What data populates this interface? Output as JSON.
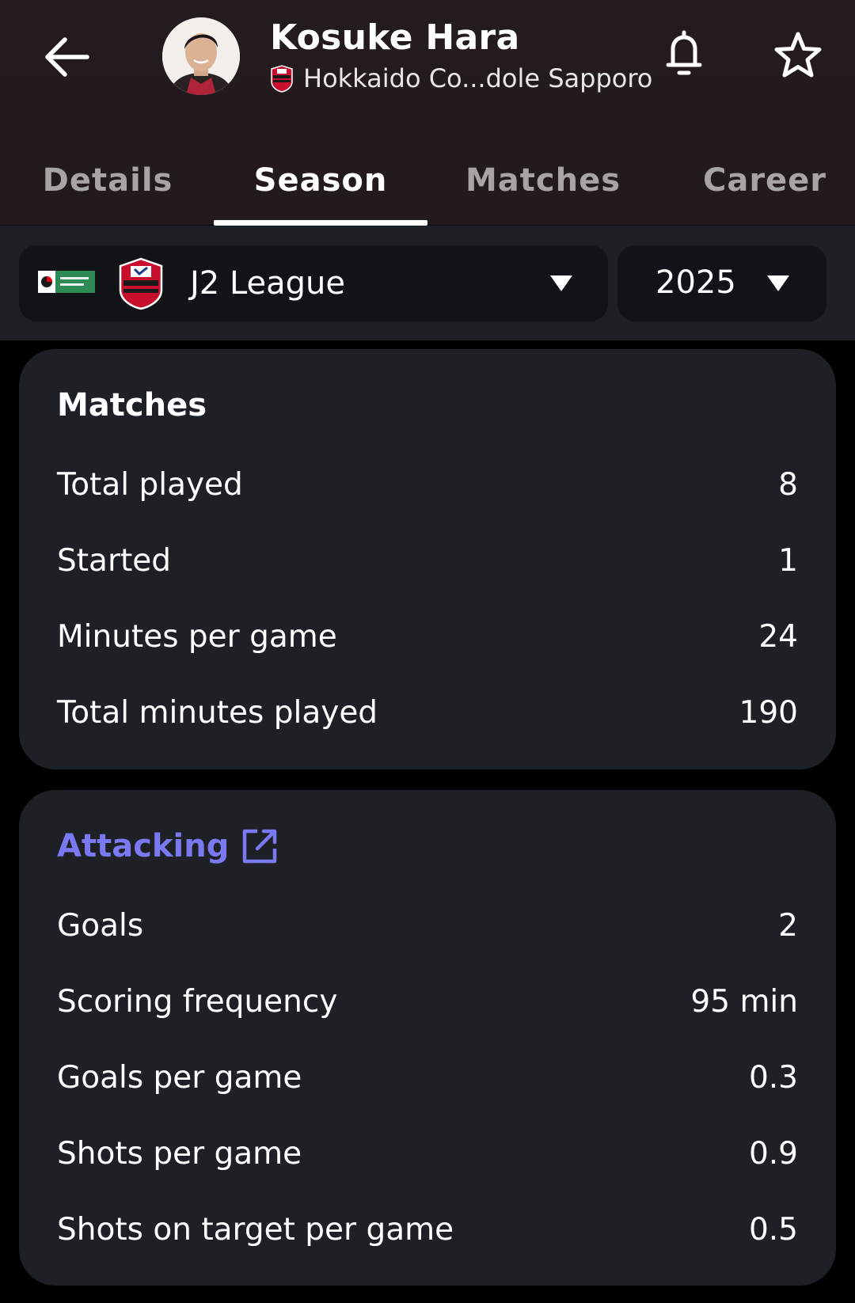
{
  "header": {
    "player_name": "Kosuke Hara",
    "team_name": "Hokkaido Co...dole Sapporo"
  },
  "tabs": [
    {
      "label": "Details",
      "active": false
    },
    {
      "label": "Season",
      "active": true
    },
    {
      "label": "Matches",
      "active": false
    },
    {
      "label": "Career",
      "active": false
    }
  ],
  "filters": {
    "league": "J2 League",
    "year": "2025"
  },
  "matches": {
    "title": "Matches",
    "rows": [
      {
        "label": "Total played",
        "value": "8"
      },
      {
        "label": "Started",
        "value": "1"
      },
      {
        "label": "Minutes per game",
        "value": "24"
      },
      {
        "label": "Total minutes played",
        "value": "190"
      }
    ]
  },
  "attacking": {
    "title": "Attacking",
    "rows": [
      {
        "label": "Goals",
        "value": "2"
      },
      {
        "label": "Scoring frequency",
        "value": "95 min"
      },
      {
        "label": "Goals per game",
        "value": "0.3"
      },
      {
        "label": "Shots per game",
        "value": "0.9"
      },
      {
        "label": "Shots on target per game",
        "value": "0.5"
      }
    ]
  },
  "colors": {
    "header_bg": "#231b1e",
    "card_bg": "#1d2025",
    "accent": "#7b79f2",
    "select_bg": "#111317"
  },
  "icons": [
    "back-arrow-icon",
    "bell-icon",
    "star-icon",
    "caret-down-icon",
    "external-link-icon",
    "team-crest-icon",
    "league-logo-icon"
  ]
}
